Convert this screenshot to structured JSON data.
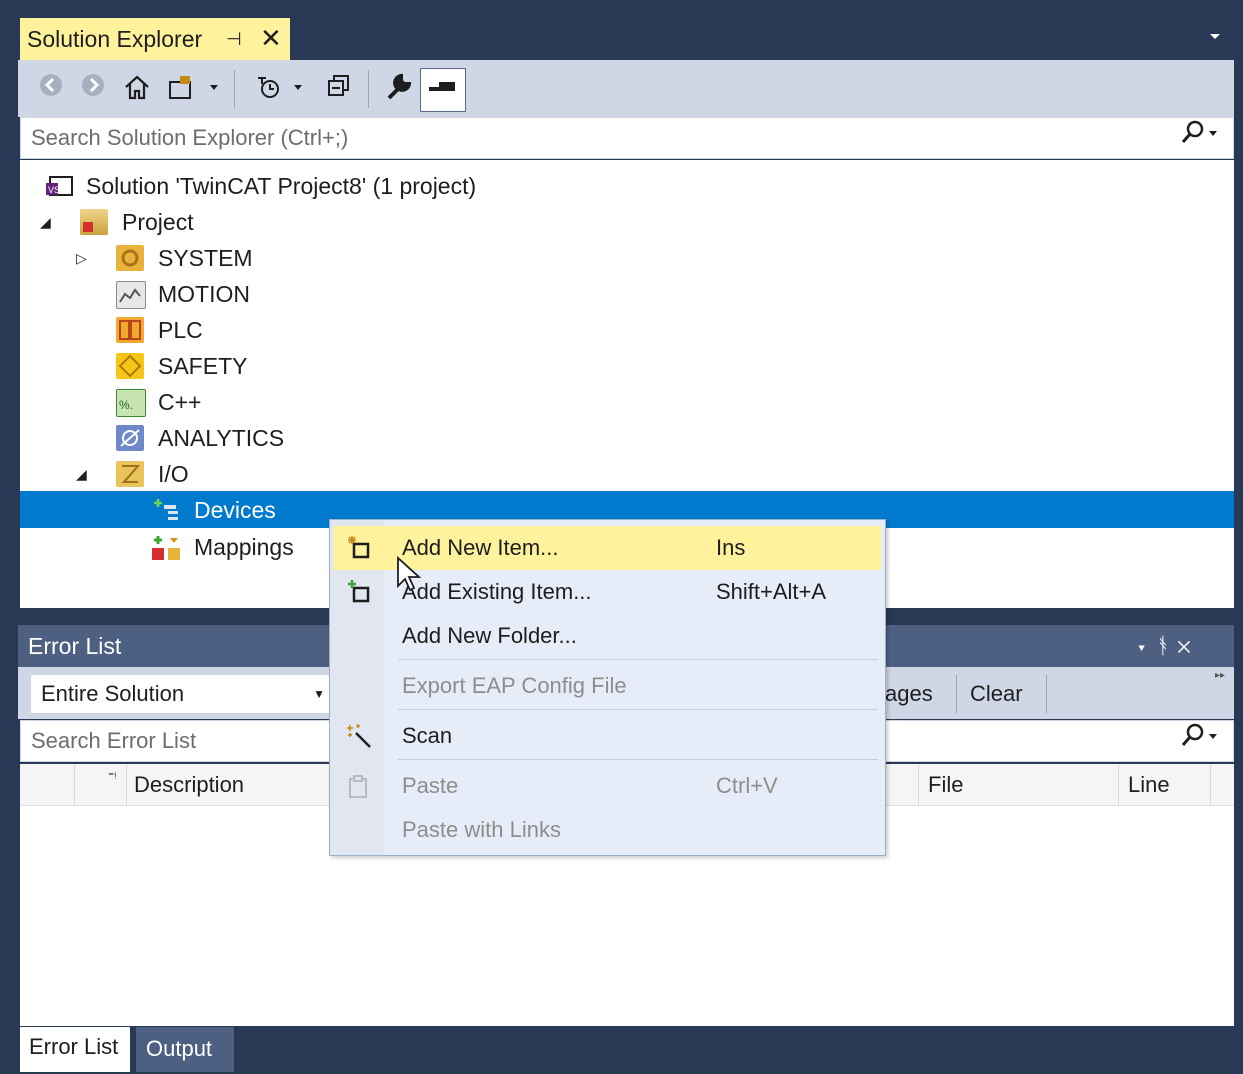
{
  "solution_explorer": {
    "tab_title": "Solution Explorer",
    "pin_glyph": "⊣",
    "close_glyph": "✕",
    "search_placeholder": "Search Solution Explorer (Ctrl+;)",
    "tree": {
      "solution": "Solution 'TwinCAT Project8' (1 project)",
      "project": "Project",
      "nodes": [
        "SYSTEM",
        "MOTION",
        "PLC",
        "SAFETY",
        "C++",
        "ANALYTICS",
        "I/O"
      ],
      "io_children": [
        "Devices",
        "Mappings"
      ]
    }
  },
  "error_list": {
    "title": "Error List",
    "scope": "Entire Solution",
    "messages_label": "ages",
    "clear_label": "Clear",
    "search_placeholder": "Search Error List",
    "columns": [
      "Description",
      "File",
      "Line"
    ],
    "tabs": [
      "Error List",
      "Output"
    ]
  },
  "context_menu": {
    "items": [
      {
        "label": "Add New Item...",
        "shortcut": "Ins",
        "icon": "add-new-item-icon",
        "highlighted": true
      },
      {
        "label": "Add Existing Item...",
        "shortcut": "Shift+Alt+A",
        "icon": "add-existing-item-icon"
      },
      {
        "label": "Add New Folder...",
        "shortcut": ""
      },
      {
        "label": "Export EAP Config File",
        "shortcut": "",
        "disabled": true
      },
      {
        "label": "Scan",
        "shortcut": "",
        "icon": "magic-wand-icon"
      },
      {
        "label": "Paste",
        "shortcut": "Ctrl+V",
        "icon": "paste-icon",
        "disabled": true
      },
      {
        "label": "Paste with Links",
        "shortcut": "",
        "disabled": true
      }
    ]
  },
  "colors": {
    "frame": "#293955",
    "active_tab": "#fff29d",
    "selection": "#007acc",
    "menu_bg": "#e7edf8"
  }
}
